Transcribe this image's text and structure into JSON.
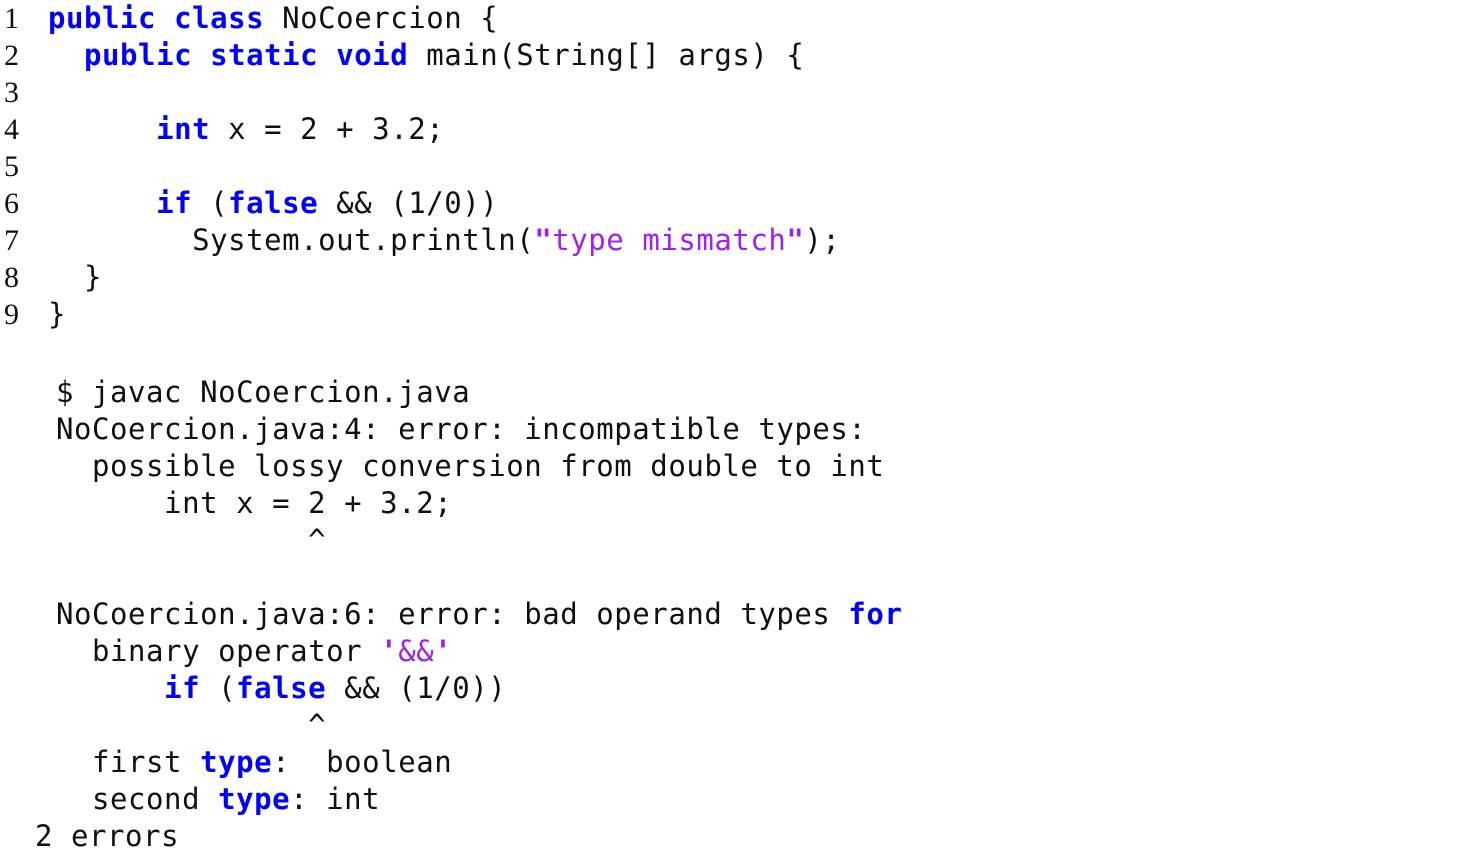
{
  "page": {
    "background_color": "#ffffff",
    "text_color": "#101010",
    "keyword_color": "#0000ff",
    "string_color": "#a020f0",
    "kind": "java-source-listing-with-compiler-output"
  },
  "listing": {
    "file_name": "NoCoercion.java",
    "class_name": "NoCoercion",
    "line_numbers": [
      "1",
      "2",
      "3",
      "4",
      "5",
      "6",
      "7",
      "8",
      "9"
    ],
    "lines": [
      {
        "no": "1",
        "text": "public class NoCoercion {",
        "tokens": [
          {
            "t": "public",
            "c": "kw"
          },
          {
            "t": " ",
            "c": "plain"
          },
          {
            "t": "class",
            "c": "kw"
          },
          {
            "t": " NoCoercion {",
            "c": "plain"
          }
        ]
      },
      {
        "no": "2",
        "text": "   public static void main(String[] args) {",
        "tokens": [
          {
            "t": "  ",
            "c": "plain"
          },
          {
            "t": "public",
            "c": "kw"
          },
          {
            "t": " ",
            "c": "plain"
          },
          {
            "t": "static",
            "c": "kw"
          },
          {
            "t": " ",
            "c": "plain"
          },
          {
            "t": "void",
            "c": "kw"
          },
          {
            "t": " main(String[] args) {",
            "c": "plain"
          }
        ]
      },
      {
        "no": "3",
        "text": "",
        "tokens": []
      },
      {
        "no": "4",
        "text": "      int x = 2 + 3.2;",
        "tokens": [
          {
            "t": "      ",
            "c": "plain"
          },
          {
            "t": "int",
            "c": "kw"
          },
          {
            "t": " x = 2 + 3.2;",
            "c": "plain"
          }
        ]
      },
      {
        "no": "5",
        "text": "",
        "tokens": []
      },
      {
        "no": "6",
        "text": "      if (false && (1/0))",
        "tokens": [
          {
            "t": "      ",
            "c": "plain"
          },
          {
            "t": "if",
            "c": "kw"
          },
          {
            "t": " (",
            "c": "plain"
          },
          {
            "t": "false",
            "c": "kw"
          },
          {
            "t": " && (1/0))",
            "c": "plain"
          }
        ]
      },
      {
        "no": "7",
        "text": "        System.out.println(\"type mismatch\");",
        "tokens": [
          {
            "t": "        System.out.println(",
            "c": "plain"
          },
          {
            "t": "\"",
            "c": "strq"
          },
          {
            "t": "type mismatch",
            "c": "str"
          },
          {
            "t": "\"",
            "c": "strq"
          },
          {
            "t": ");",
            "c": "plain"
          }
        ]
      },
      {
        "no": "8",
        "text": "   }",
        "tokens": [
          {
            "t": "  }",
            "c": "plain"
          }
        ]
      },
      {
        "no": "9",
        "text": "}",
        "tokens": [
          {
            "t": "}",
            "c": "plain"
          }
        ]
      }
    ]
  },
  "transcript": {
    "prompt_symbol": "$",
    "command": "javac NoCoercion.java",
    "error_count_text": "2 errors",
    "lines": [
      {
        "id": "command",
        "text": "$ javac NoCoercion.java",
        "tokens": [
          {
            "t": "$ javac NoCoercion.java",
            "c": "plain"
          }
        ]
      },
      {
        "id": "error-1-header",
        "text": "NoCoercion.java:4: error: incompatible types:",
        "tokens": [
          {
            "t": "NoCoercion.java:4: error: incompatible types:",
            "c": "plain"
          }
        ]
      },
      {
        "id": "error-1-detail",
        "text": "  possible lossy conversion from double to int",
        "tokens": [
          {
            "t": "  possible lossy conversion from double to int",
            "c": "plain"
          }
        ]
      },
      {
        "id": "error-1-source",
        "text": "      int x = 2 + 3.2;",
        "tokens": [
          {
            "t": "      int x = 2 + 3.2;",
            "c": "plain"
          }
        ]
      },
      {
        "id": "error-1-caret",
        "text": "              ^",
        "tokens": [
          {
            "t": "              ^",
            "c": "plain"
          }
        ]
      },
      {
        "id": "spacer-1",
        "text": "",
        "tokens": []
      },
      {
        "id": "error-2-header",
        "text": "NoCoercion.java:6: error: bad operand types for",
        "tokens": [
          {
            "t": "NoCoercion.java:6: error: bad operand types ",
            "c": "plain"
          },
          {
            "t": "for",
            "c": "kw"
          }
        ]
      },
      {
        "id": "error-2-detail",
        "text": "  binary operator '&&'",
        "tokens": [
          {
            "t": "  binary operator ",
            "c": "plain"
          },
          {
            "t": "'",
            "c": "strq"
          },
          {
            "t": "&&",
            "c": "str"
          },
          {
            "t": "'",
            "c": "strq"
          }
        ]
      },
      {
        "id": "error-2-source",
        "text": "      if (false && (1/0))",
        "tokens": [
          {
            "t": "      ",
            "c": "plain"
          },
          {
            "t": "if",
            "c": "kw"
          },
          {
            "t": " (",
            "c": "plain"
          },
          {
            "t": "false",
            "c": "kw"
          },
          {
            "t": " && (1/0))",
            "c": "plain"
          }
        ]
      },
      {
        "id": "error-2-caret",
        "text": "              ^",
        "tokens": [
          {
            "t": "              ^",
            "c": "plain"
          }
        ]
      },
      {
        "id": "error-2-first-type",
        "text": "  first type:  boolean",
        "tokens": [
          {
            "t": "  first ",
            "c": "plain"
          },
          {
            "t": "type",
            "c": "kw"
          },
          {
            "t": ":  boolean",
            "c": "plain"
          }
        ]
      },
      {
        "id": "error-2-second-type",
        "text": "  second type: int",
        "tokens": [
          {
            "t": "  second ",
            "c": "plain"
          },
          {
            "t": "type",
            "c": "kw"
          },
          {
            "t": ": int",
            "c": "plain"
          }
        ]
      },
      {
        "id": "error-count",
        "text": "2 errors",
        "tokens": [
          {
            "t": "2 errors",
            "c": "plain"
          }
        ],
        "outdent": true
      }
    ]
  }
}
